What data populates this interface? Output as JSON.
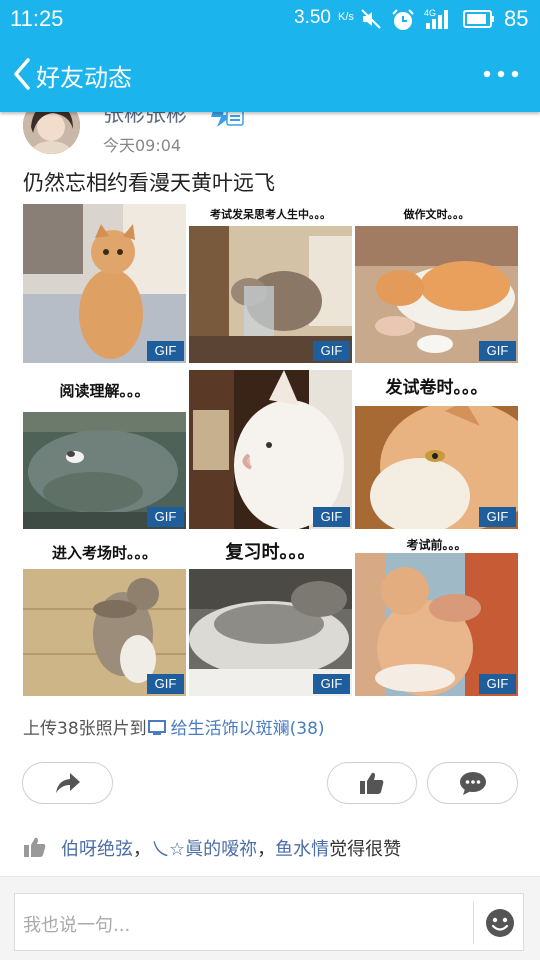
{
  "status_bar": {
    "time": "11:25",
    "net_speed": "3.50",
    "net_unit": "K/s",
    "network_type": "4G",
    "battery": "85"
  },
  "header": {
    "title": "好友动态"
  },
  "post": {
    "username": "张彬张彬",
    "time": "今天09:04",
    "text": "仍然忘相约看漫天黄叶远飞",
    "images": [
      {
        "caption": "",
        "badge": "GIF"
      },
      {
        "caption": "考试发呆思考人生中。。。",
        "badge": "GIF"
      },
      {
        "caption": "做作文时。。。",
        "badge": "GIF"
      },
      {
        "caption": "阅读理解。。。",
        "badge": "GIF"
      },
      {
        "caption": "",
        "badge": "GIF"
      },
      {
        "caption": "发试卷时。。。",
        "badge": "GIF"
      },
      {
        "caption": "进入考场时。。。",
        "badge": "GIF"
      },
      {
        "caption": "复习时。。。",
        "badge": "GIF"
      },
      {
        "caption": "考试前。。。",
        "badge": "GIF"
      }
    ],
    "upload_prefix": "上传38张照片到",
    "album_name": "给生活饰以斑斓(38)"
  },
  "likes": {
    "names": [
      "伯呀绝弦",
      "乀☆眞的嗳祢",
      "鱼水情"
    ],
    "sep1": "，",
    "sep2": "，",
    "suffix": "觉得很赞"
  },
  "comment": {
    "placeholder": "我也说一句..."
  },
  "icons": {
    "back": "back-arrow-icon",
    "more": "more-dots-icon",
    "share": "share-icon",
    "like": "thumbs-up-icon",
    "comment": "comment-bubble-icon",
    "emoji": "emoji-icon"
  },
  "colors": {
    "brand": "#1cb4ec",
    "gif_badge": "#1f5e9c",
    "link": "#4a6ea8"
  }
}
